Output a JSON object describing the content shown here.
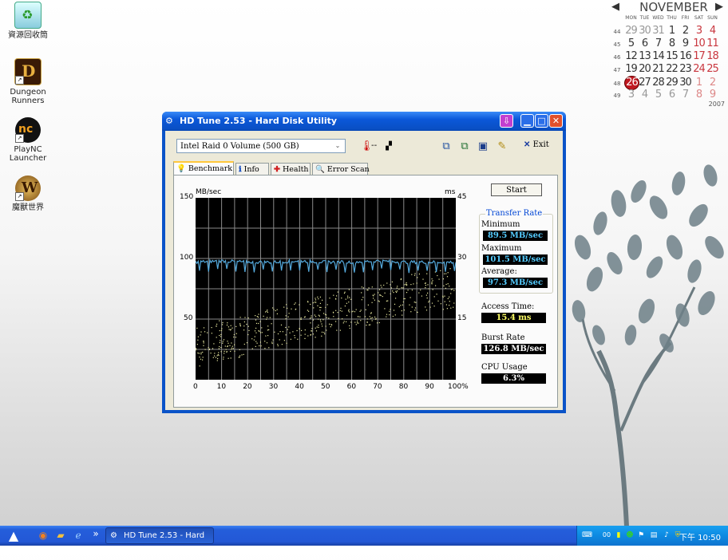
{
  "desktop": {
    "icons": [
      {
        "label": "資源回收筒",
        "icon": "recycle-bin-icon"
      },
      {
        "label": "Dungeon Runners",
        "icon": "dungeon-runners-icon"
      },
      {
        "label": "PlayNC Launcher",
        "icon": "plaync-icon"
      },
      {
        "label": "魔獸世界",
        "icon": "world-of-warcraft-icon"
      }
    ]
  },
  "calendar": {
    "month": "NOVEMBER",
    "year": "2007",
    "dows": [
      "MON",
      "TUE",
      "WED",
      "THU",
      "FRI",
      "SAT",
      "SUN"
    ],
    "weeks": [
      {
        "wk": "44",
        "days": [
          "29",
          "30",
          "31",
          "1",
          "2",
          "3",
          "4"
        ]
      },
      {
        "wk": "45",
        "days": [
          "5",
          "6",
          "7",
          "8",
          "9",
          "10",
          "11"
        ]
      },
      {
        "wk": "46",
        "days": [
          "12",
          "13",
          "14",
          "15",
          "16",
          "17",
          "18"
        ]
      },
      {
        "wk": "47",
        "days": [
          "19",
          "20",
          "21",
          "22",
          "23",
          "24",
          "25"
        ]
      },
      {
        "wk": "48",
        "days": [
          "26",
          "27",
          "28",
          "29",
          "30",
          "1",
          "2"
        ]
      },
      {
        "wk": "49",
        "days": [
          "3",
          "4",
          "5",
          "6",
          "7",
          "8",
          "9"
        ]
      }
    ],
    "today": "26"
  },
  "window": {
    "title": "HD Tune 2.53 - Hard Disk Utility",
    "drive": "Intel   Raid 0 Volume (500 GB)",
    "temperature": "--",
    "exit_label": "Exit",
    "tabs": [
      "Benchmark",
      "Info",
      "Health",
      "Error Scan"
    ],
    "start_label": "Start",
    "transfer_rate_title": "Transfer Rate",
    "minimum_label": "Minimum",
    "minimum_value": "89.5 MB/sec",
    "maximum_label": "Maximum",
    "maximum_value": "101.5 MB/sec",
    "average_label": "Average:",
    "average_value": "97.3 MB/sec",
    "access_label": "Access Time:",
    "access_value": "15.4 ms",
    "burst_label": "Burst Rate",
    "burst_value": "126.8 MB/sec",
    "cpu_label": "CPU Usage",
    "cpu_value": "6.3%"
  },
  "chart_data": {
    "type": "line",
    "y_left_label": "MB/sec",
    "y_right_label": "ms",
    "y_left_ticks": [
      "150",
      "100",
      "50"
    ],
    "y_right_ticks": [
      "45",
      "30",
      "15"
    ],
    "x_ticks": [
      "0",
      "10",
      "20",
      "30",
      "40",
      "50",
      "60",
      "70",
      "80",
      "90",
      "100%"
    ],
    "ylim": [
      0,
      150
    ],
    "y2lim": [
      0,
      45
    ],
    "xlim": [
      0,
      100
    ],
    "grid": true,
    "series": [
      {
        "values_x": [
          0,
          10,
          20,
          30,
          40,
          50,
          60,
          70,
          80,
          90,
          100
        ],
        "values": [
          97,
          98,
          97,
          97,
          98,
          97,
          97,
          98,
          97,
          97,
          97
        ]
      },
      {
        "type": "scatter",
        "x": [
          0,
          10,
          20,
          30,
          40,
          50,
          60,
          70,
          80,
          90,
          100
        ],
        "values": [
          8,
          10,
          11,
          13,
          15,
          16,
          18,
          19,
          21,
          22,
          23
        ]
      }
    ],
    "colors": {
      "transfer": "#55aadd",
      "access": "#e8e8a0",
      "background": "#000000",
      "grid": "#8a8a8a"
    }
  },
  "taskbar": {
    "task_label": "HD Tune 2.53 - Hard ...",
    "chevron": "»",
    "clock": "下午 10:50",
    "tray_text": "00"
  }
}
